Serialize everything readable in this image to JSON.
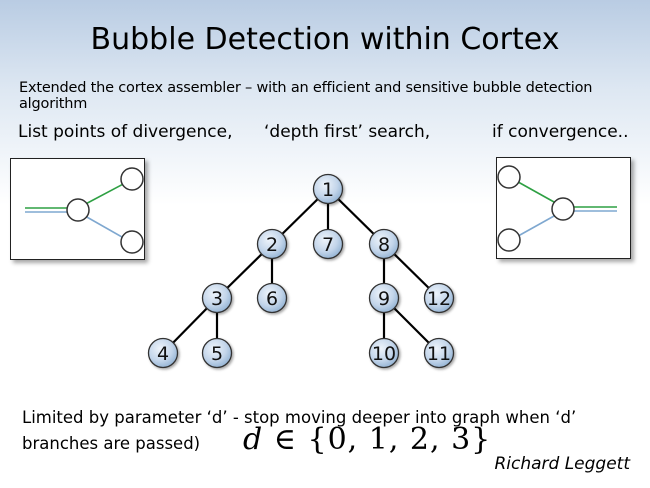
{
  "slide": {
    "title": "Bubble Detection within Cortex",
    "subtitle": "Extended the cortex assembler – with an efficient and sensitive bubble detection algorithm",
    "steps": [
      "List points of divergence,",
      "‘depth first’ search,",
      "if convergence.."
    ],
    "limit_line1": "Limited by parameter ‘d’ -  stop moving deeper into graph when ‘d’",
    "limit_line2": "branches are passed)",
    "formula_var": "d",
    "formula_rest": " ∈ {0, 1, 2, 3}",
    "author": "Richard Leggett"
  },
  "tree": {
    "nodes": [
      "1",
      "2",
      "7",
      "8",
      "3",
      "6",
      "9",
      "12",
      "4",
      "5",
      "10",
      "11"
    ],
    "edges": [
      [
        "1",
        "2"
      ],
      [
        "1",
        "7"
      ],
      [
        "1",
        "8"
      ],
      [
        "2",
        "3"
      ],
      [
        "2",
        "6"
      ],
      [
        "8",
        "9"
      ],
      [
        "8",
        "12"
      ],
      [
        "3",
        "4"
      ],
      [
        "3",
        "5"
      ],
      [
        "9",
        "10"
      ],
      [
        "9",
        "11"
      ]
    ]
  },
  "colors": {
    "node_fill_light": "#e6eef8",
    "node_fill_dark": "#8fb0d2",
    "node_stroke": "#333333",
    "edge": "#000000",
    "path_green": "#2ea043",
    "path_blue": "#7fa8d0"
  }
}
